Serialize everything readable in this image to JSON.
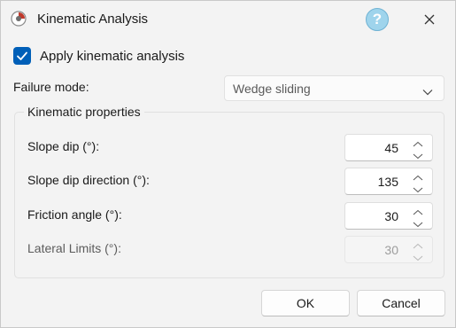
{
  "window": {
    "title": "Kinematic Analysis"
  },
  "icons": {
    "app": "app-logo-icon",
    "help": "help-icon",
    "close": "close-icon",
    "check": "checkmark-icon",
    "chevron": "chevron-down-icon",
    "spin_up": "spin-up-icon",
    "spin_down": "spin-down-icon"
  },
  "help_button": {
    "glyph": "?"
  },
  "apply_checkbox": {
    "label": "Apply kinematic analysis",
    "checked": true
  },
  "failure_mode": {
    "label": "Failure mode:",
    "value": "Wedge sliding"
  },
  "kinematic_properties": {
    "title": "Kinematic properties",
    "fields": [
      {
        "label": "Slope dip (°):",
        "value": "45",
        "enabled": true
      },
      {
        "label": "Slope dip direction (°):",
        "value": "135",
        "enabled": true
      },
      {
        "label": "Friction angle (°):",
        "value": "30",
        "enabled": true
      },
      {
        "label": "Lateral Limits (°):",
        "value": "30",
        "enabled": false
      }
    ]
  },
  "buttons": {
    "ok": "OK",
    "cancel": "Cancel"
  },
  "colors": {
    "accent": "#005fb8",
    "help_fill": "#9fd4ec",
    "background": "#f3f3f3"
  }
}
